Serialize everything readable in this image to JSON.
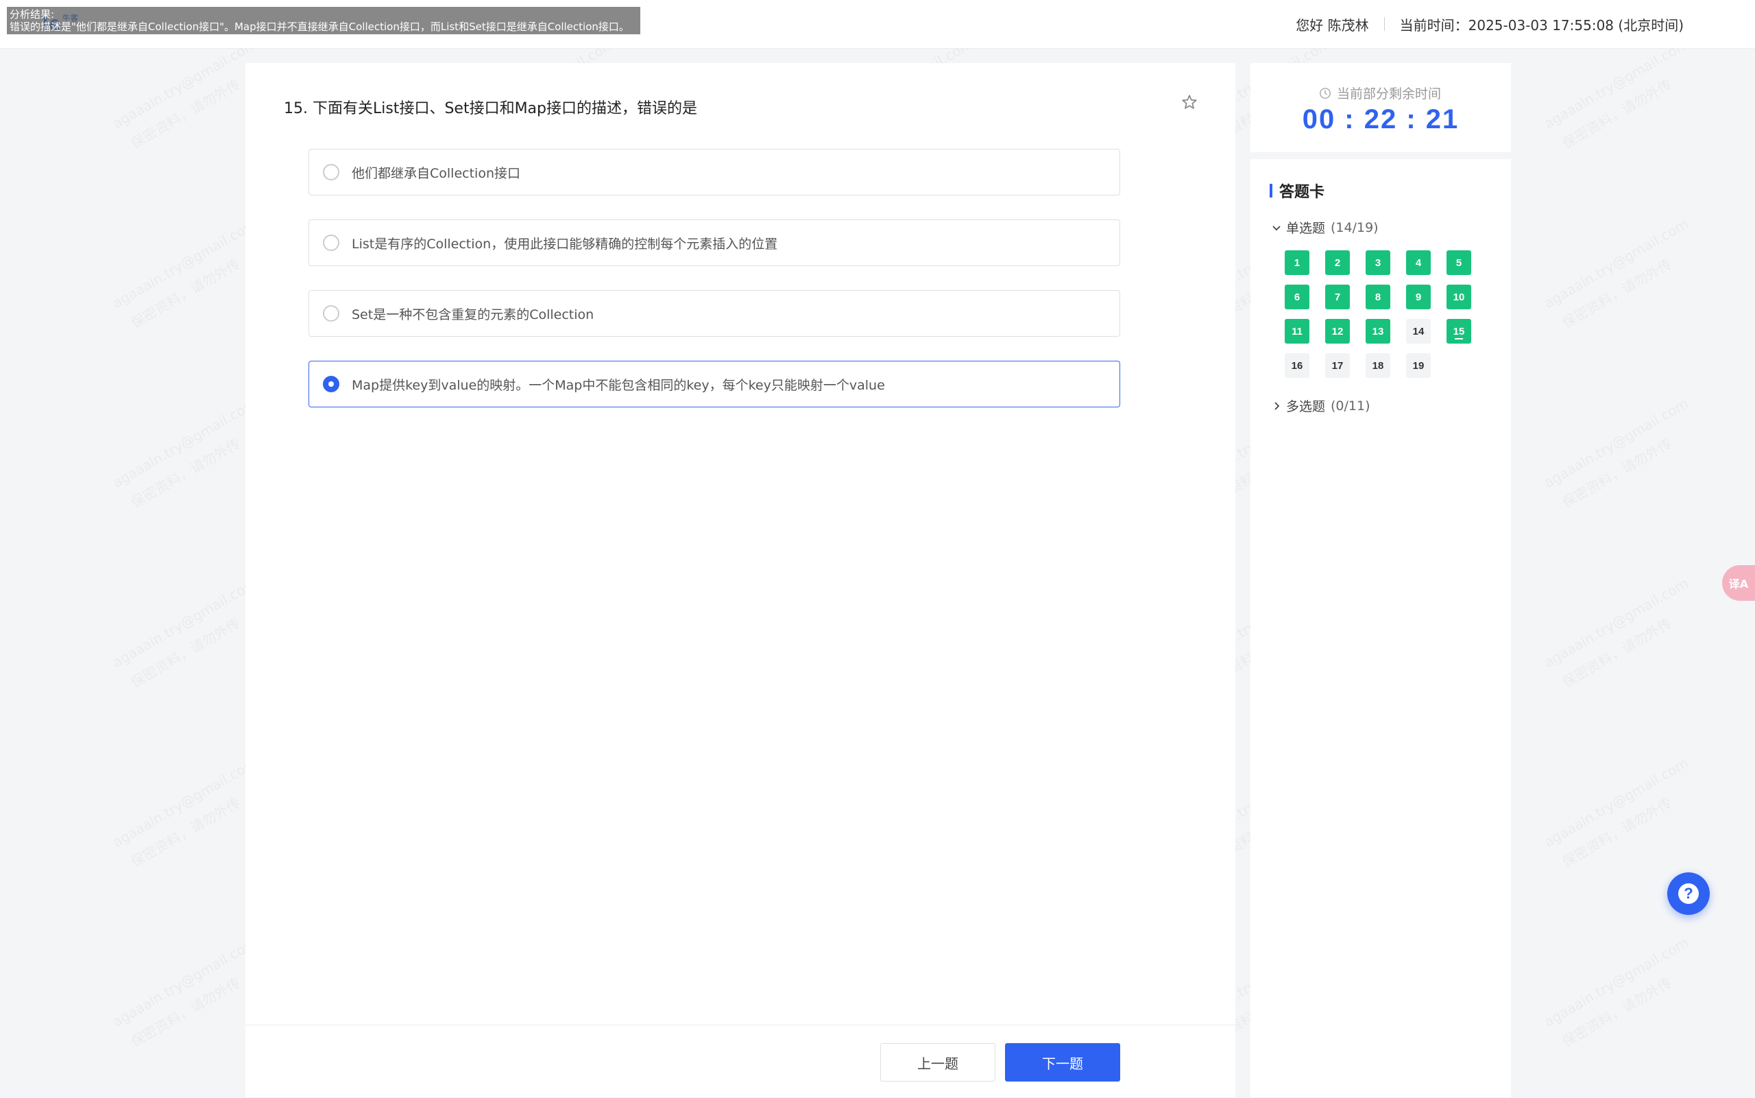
{
  "header": {
    "logo_text": "le",
    "logo_sub": "牛客",
    "analysis_label": "分析结果:",
    "analysis_text": "错误的描述是\"他们都是继承自Collection接口\"。Map接口并不直接继承自Collection接口，而List和Set接口是继承自Collection接口。",
    "greeting": "您好 陈茂林",
    "current_time": "当前时间：2025-03-03 17:55:08 (北京时间)"
  },
  "question": {
    "title": "15. 下面有关List接口、Set接口和Map接口的描述，错误的是",
    "options": [
      {
        "text": "他们都继承自Collection接口",
        "selected": false
      },
      {
        "text": "List是有序的Collection，使用此接口能够精确的控制每个元素插入的位置",
        "selected": false
      },
      {
        "text": "Set是一种不包含重复的元素的Collection",
        "selected": false
      },
      {
        "text": "Map提供key到value的映射。一个Map中不能包含相同的key，每个key只能映射一个value",
        "selected": true
      }
    ]
  },
  "nav": {
    "prev_label": "上一题",
    "next_label": "下一题"
  },
  "timer": {
    "label": "当前部分剩余时间",
    "value": "00 : 22 : 21"
  },
  "answer_card": {
    "title": "答题卡",
    "single": {
      "label": "单选题",
      "count": "(14/19)"
    },
    "multi": {
      "label": "多选题",
      "count": "(0/11)"
    },
    "numbers": [
      {
        "n": "1",
        "state": "done"
      },
      {
        "n": "2",
        "state": "done"
      },
      {
        "n": "3",
        "state": "done"
      },
      {
        "n": "4",
        "state": "done"
      },
      {
        "n": "5",
        "state": "done"
      },
      {
        "n": "6",
        "state": "done"
      },
      {
        "n": "7",
        "state": "done"
      },
      {
        "n": "8",
        "state": "done"
      },
      {
        "n": "9",
        "state": "done"
      },
      {
        "n": "10",
        "state": "done"
      },
      {
        "n": "11",
        "state": "done"
      },
      {
        "n": "12",
        "state": "done"
      },
      {
        "n": "13",
        "state": "done"
      },
      {
        "n": "14",
        "state": "todo"
      },
      {
        "n": "15",
        "state": "done current"
      },
      {
        "n": "16",
        "state": "todo"
      },
      {
        "n": "17",
        "state": "todo"
      },
      {
        "n": "18",
        "state": "todo"
      },
      {
        "n": "19",
        "state": "todo"
      }
    ]
  },
  "floating": {
    "translate_label": "译A",
    "help_label": "?"
  },
  "watermark": {
    "line1": "agaaaln.try@gmail.com",
    "line2": "保密资料，请勿外传"
  },
  "colors": {
    "primary": "#2f62f0",
    "done": "#18c27d"
  }
}
